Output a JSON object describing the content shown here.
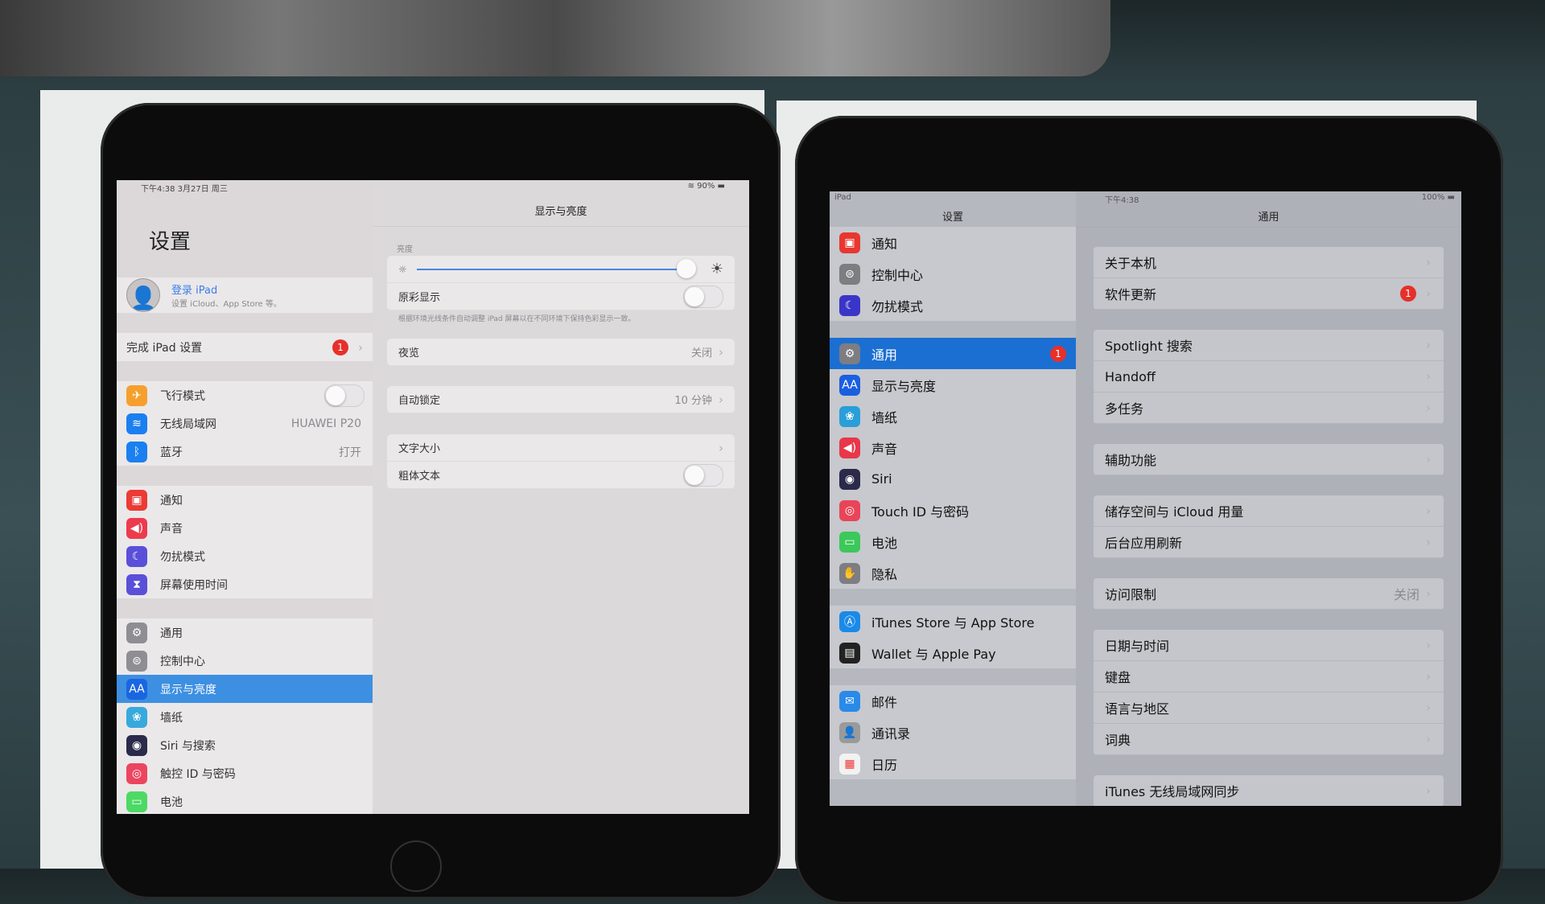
{
  "colors": {
    "left_selected": "#3d8fe2",
    "right_selected": "#1b6fd2",
    "badge": "#e6302a"
  },
  "left_ipad": {
    "status": {
      "time_date": "下午4:38  3月27日 周三",
      "battery": "90%"
    },
    "master": {
      "title": "设置",
      "profile": {
        "name": "登录 iPad",
        "subtitle": "设置 iCloud、App Store 等。"
      },
      "groups": [
        [
          {
            "label": "完成 iPad 设置",
            "badge": "1",
            "chevron": true
          }
        ],
        [
          {
            "label": "飞行模式",
            "icon": "airplane-icon",
            "color": "#f5a02e",
            "glyph": "✈",
            "toggle": false
          },
          {
            "label": "无线局域网",
            "icon": "wifi-icon",
            "color": "#1a7ff0",
            "glyph": "≋",
            "value": "HUAWEI P20"
          },
          {
            "label": "蓝牙",
            "icon": "bluetooth-icon",
            "color": "#1a7ff0",
            "glyph": "ᛒ",
            "value": "打开"
          }
        ],
        [
          {
            "label": "通知",
            "icon": "notifications-icon",
            "color": "#ec3b35",
            "glyph": "▣"
          },
          {
            "label": "声音",
            "icon": "sound-icon",
            "color": "#ec3b4d",
            "glyph": "◀)"
          },
          {
            "label": "勿扰模式",
            "icon": "moon-icon",
            "color": "#5a4fd8",
            "glyph": "☾"
          },
          {
            "label": "屏幕使用时间",
            "icon": "hourglass-icon",
            "color": "#5a4fd8",
            "glyph": "⧗"
          }
        ],
        [
          {
            "label": "通用",
            "icon": "gear-icon",
            "color": "#8e8e93",
            "glyph": "⚙"
          },
          {
            "label": "控制中心",
            "icon": "switches-icon",
            "color": "#8e8e93",
            "glyph": "⊜"
          },
          {
            "label": "显示与亮度",
            "icon": "display-icon",
            "color": "#1a66e0",
            "glyph": "AA",
            "selected": true
          },
          {
            "label": "墙纸",
            "icon": "wallpaper-icon",
            "color": "#38a9dc",
            "glyph": "❀"
          },
          {
            "label": "Siri 与搜索",
            "icon": "siri-icon",
            "color": "#2a2a4a",
            "glyph": "◉"
          },
          {
            "label": "触控 ID 与密码",
            "icon": "fingerprint-icon",
            "color": "#ec4560",
            "glyph": "◎"
          },
          {
            "label": "电池",
            "icon": "battery-icon",
            "color": "#4cd964",
            "glyph": "▭"
          }
        ]
      ]
    },
    "detail": {
      "title": "显示与亮度",
      "brightness_label": "亮度",
      "brightness_level": 0.97,
      "true_tone": {
        "label": "原彩显示",
        "toggle": false
      },
      "true_tone_note": "根据环境光线条件自动调整 iPad 屏幕以在不同环境下保持色彩显示一致。",
      "night_shift": {
        "label": "夜览",
        "value": "关闭"
      },
      "auto_lock": {
        "label": "自动锁定",
        "value": "10 分钟"
      },
      "text_size": {
        "label": "文字大小"
      },
      "bold_text": {
        "label": "粗体文本",
        "toggle": false
      }
    }
  },
  "right_ipad": {
    "status": {
      "carrier": "iPad",
      "time": "下午4:38",
      "battery": "100%"
    },
    "master": {
      "title": "设置",
      "groups": [
        [
          {
            "label": "通知",
            "icon": "notifications-icon",
            "color": "#e8372f",
            "glyph": "▣"
          },
          {
            "label": "控制中心",
            "icon": "switches-icon",
            "color": "#7d7d82",
            "glyph": "⊜"
          },
          {
            "label": "勿扰模式",
            "icon": "moon-icon",
            "color": "#3a35c8",
            "glyph": "☾"
          }
        ],
        [
          {
            "label": "通用",
            "icon": "gear-icon",
            "color": "#7d7d82",
            "glyph": "⚙",
            "selected": true,
            "badge": "1"
          },
          {
            "label": "显示与亮度",
            "icon": "display-icon",
            "color": "#1a5fe0",
            "glyph": "AA"
          },
          {
            "label": "墙纸",
            "icon": "wallpaper-icon",
            "color": "#2a9ed8",
            "glyph": "❀"
          },
          {
            "label": "声音",
            "icon": "sound-icon",
            "color": "#e8374a",
            "glyph": "◀)"
          },
          {
            "label": "Siri",
            "icon": "siri-icon",
            "color": "#2a2a4a",
            "glyph": "◉"
          },
          {
            "label": "Touch ID 与密码",
            "icon": "fingerprint-icon",
            "color": "#e84558",
            "glyph": "◎"
          },
          {
            "label": "电池",
            "icon": "battery-icon",
            "color": "#3cc85a",
            "glyph": "▭"
          },
          {
            "label": "隐私",
            "icon": "hand-icon",
            "color": "#7d7d82",
            "glyph": "✋"
          }
        ],
        [
          {
            "label": "iTunes Store 与 App Store",
            "icon": "app-store-icon",
            "color": "#1a8ae8",
            "glyph": "Ⓐ"
          },
          {
            "label": "Wallet 与 Apple Pay",
            "icon": "wallet-icon",
            "color": "#222",
            "glyph": "▤"
          }
        ],
        [
          {
            "label": "邮件",
            "icon": "mail-icon",
            "color": "#2a8ae8",
            "glyph": "✉"
          },
          {
            "label": "通讯录",
            "icon": "contacts-icon",
            "color": "#9a9a9a",
            "glyph": "👤"
          },
          {
            "label": "日历",
            "icon": "calendar-icon",
            "color": "#f2f2f2",
            "glyph": "▦"
          }
        ]
      ]
    },
    "detail": {
      "title": "通用",
      "groups": [
        [
          {
            "label": "关于本机"
          },
          {
            "label": "软件更新",
            "badge": "1"
          }
        ],
        [
          {
            "label": "Spotlight 搜索"
          },
          {
            "label": "Handoff"
          },
          {
            "label": "多任务"
          }
        ],
        [
          {
            "label": "辅助功能"
          }
        ],
        [
          {
            "label": "储存空间与 iCloud 用量"
          },
          {
            "label": "后台应用刷新"
          }
        ],
        [
          {
            "label": "访问限制",
            "value": "关闭"
          }
        ],
        [
          {
            "label": "日期与时间"
          },
          {
            "label": "键盘"
          },
          {
            "label": "语言与地区"
          },
          {
            "label": "词典"
          }
        ],
        [
          {
            "label": "iTunes 无线局域网同步"
          }
        ]
      ]
    }
  }
}
